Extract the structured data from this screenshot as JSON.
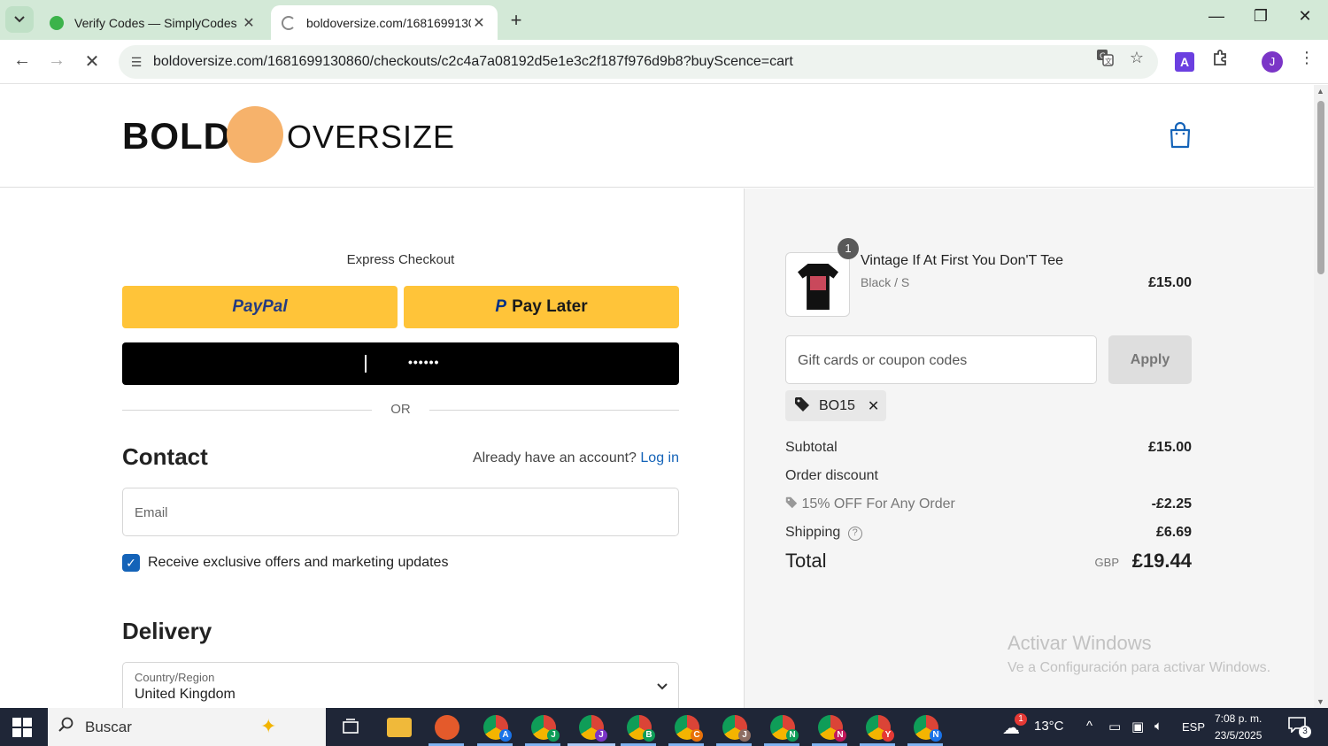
{
  "browser": {
    "tabs": [
      {
        "title": "Verify Codes — SimplyCodes",
        "active": false,
        "favicon_color": "#3bb34a"
      },
      {
        "title": "boldoversize.com/16816991308",
        "active": true,
        "favicon_color": "#888888"
      }
    ],
    "url": "boldoversize.com/1681699130860/checkouts/c2c4a7a08192d5e1e3c2f187f976d9b8?buyScence=cart",
    "profile_initial": "J",
    "extension_letter": "A"
  },
  "header": {
    "logo_left": "BOLD",
    "logo_right": "OVERSIZE"
  },
  "express": {
    "label": "Express Checkout",
    "paypal_label": "PayPal",
    "paylater_label": "Pay Later",
    "third_button_text": "••••••",
    "or_label": "OR"
  },
  "contact": {
    "title": "Contact",
    "have_account": "Already have an account?",
    "login_label": "Log in",
    "email_placeholder": "Email",
    "marketing_label": "Receive exclusive offers and marketing updates",
    "marketing_checked": true
  },
  "delivery": {
    "title": "Delivery",
    "country_label": "Country/Region",
    "country_value": "United Kingdom"
  },
  "summary": {
    "product": {
      "quantity": "1",
      "name": "Vintage If At First You Don'T Tee",
      "variant": "Black / S",
      "price": "£15.00"
    },
    "coupon_placeholder": "Gift cards or coupon codes",
    "apply_label": "Apply",
    "applied_code": "BO15",
    "subtotal_label": "Subtotal",
    "subtotal_value": "£15.00",
    "order_discount_label": "Order discount",
    "discount_name": "15% OFF For Any Order",
    "discount_value": "-£2.25",
    "shipping_label": "Shipping",
    "shipping_value": "£6.69",
    "total_label": "Total",
    "currency": "GBP",
    "total_value": "£19.44"
  },
  "watermark": {
    "line1": "Activar Windows",
    "line2": "Ve a Configuración para activar Windows."
  },
  "taskbar": {
    "search_placeholder": "Buscar",
    "chrome_profiles": [
      "A",
      "J",
      "J",
      "B",
      "C",
      "J",
      "N",
      "N",
      "Y",
      "N"
    ],
    "weather_badge": "1",
    "temperature": "13°C",
    "language": "ESP",
    "time": "7:08 p. m.",
    "date": "23/5/2025",
    "notification_count": "3"
  },
  "colors": {
    "paypal_yellow": "#ffc439",
    "link_blue": "#1463b8",
    "tabbar_green": "#d3e9d7"
  }
}
